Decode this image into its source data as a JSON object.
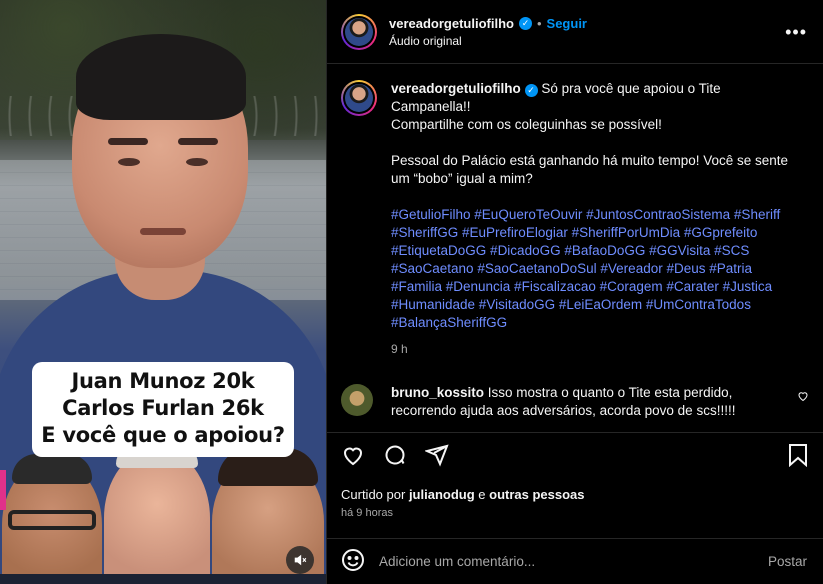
{
  "video": {
    "caption_lines": [
      "Juan Munoz 20k",
      "Carlos Furlan 26k",
      "E você que o apoiou?"
    ],
    "mute_icon": "speaker-muted-icon"
  },
  "header": {
    "username": "vereadorgetuliofilho",
    "verified_icon": "verified-badge-icon",
    "separator": "•",
    "follow_label": "Seguir",
    "audio_label": "Áudio original",
    "more_icon": "more-options-icon"
  },
  "caption": {
    "username": "vereadorgetuliofilho",
    "lines": [
      "Só pra você que apoiou o Tite",
      "Campanella!!",
      "Compartilhe com os coleguinhas se possível!"
    ],
    "lines2": [
      "Pessoal do Palácio está ganhando há muito tempo! Você se sente",
      "um “bobo” igual a mim?"
    ],
    "hashtag_lines": [
      "#GetulioFilho #EuQueroTeOuvir #JuntosContraoSistema #Sheriff",
      "#SheriffGG #EuPrefiroElogiar #SheriffPorUmDia #GGprefeito",
      "#EtiquetaDoGG #DicadoGG #BafaoDoGG #GGVisita #SCS",
      "#SaoCaetano #SaoCaetanoDoSul #Vereador #Deus #Patria",
      "#Familia #Denuncia #Fiscalizacao #Coragem #Carater #Justica",
      "#Humanidade #VisitadoGG #LeiEaOrdem #UmContraTodos",
      "#BalançaSheriffGG"
    ],
    "time": "9 h"
  },
  "comment": {
    "username": "bruno_kossito",
    "line1": "Isso mostra o quanto o Tite esta perdido,",
    "line2": "recorrendo ajuda aos adversários, acorda povo de scs!!!!!"
  },
  "actions": {
    "liked_prefix": "Curtido por",
    "liked_user": "julianodug",
    "liked_mid": "e",
    "liked_others": "outras pessoas",
    "ago": "há 9 horas"
  },
  "add_comment": {
    "placeholder": "Adicione um comentário...",
    "post_label": "Postar"
  },
  "colors": {
    "accent": "#0095f6",
    "hashtag": "#6f8dff",
    "secondary": "#a8a8a8"
  }
}
